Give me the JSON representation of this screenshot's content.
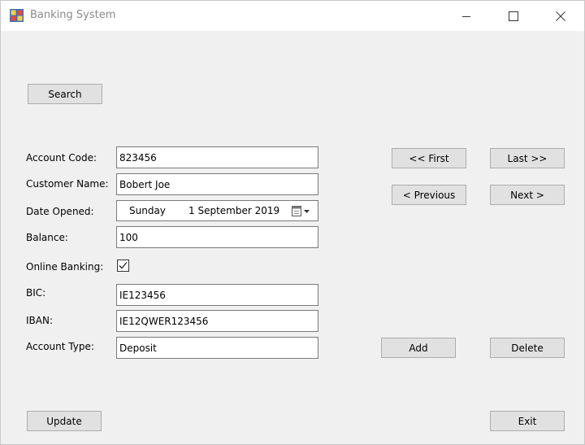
{
  "window": {
    "title": "Banking System",
    "controls": {
      "minimize": "minimize-icon",
      "maximize": "maximize-icon",
      "close": "close-icon"
    }
  },
  "buttons": {
    "search": "Search",
    "first": "<< First",
    "last": "Last >>",
    "previous": "< Previous",
    "next": "Next >",
    "add": "Add",
    "delete": "Delete",
    "update": "Update",
    "exit": "Exit"
  },
  "form": {
    "account_code": {
      "label": "Account Code:",
      "value": "823456"
    },
    "customer_name": {
      "label": "Customer Name:",
      "value": "Bobert Joe"
    },
    "date_opened": {
      "label": "Date Opened:",
      "day": "Sunday",
      "date": "1 September 2019"
    },
    "balance": {
      "label": "Balance:",
      "value": "100"
    },
    "online_banking": {
      "label": "Online Banking:",
      "checked": true
    },
    "bic": {
      "label": "BIC:",
      "value": "IE123456"
    },
    "iban": {
      "label": "IBAN:",
      "value": "IE12QWER123456"
    },
    "account_type": {
      "label": "Account Type:",
      "value": "Deposit"
    }
  }
}
